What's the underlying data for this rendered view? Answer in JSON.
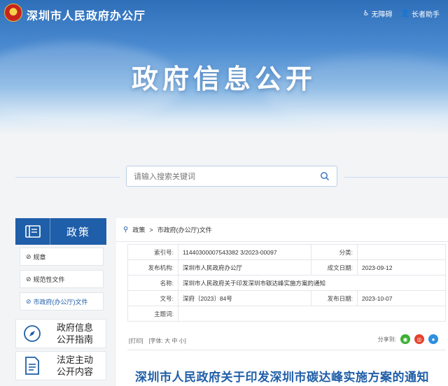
{
  "header": {
    "site_name": "深圳市人民政府办公厅",
    "barrier_free": "无障碍",
    "elder_mode": "长者助手",
    "hero_title": "政府信息公开"
  },
  "search": {
    "placeholder": "请输入搜索关键词"
  },
  "sidebar": {
    "header_label": "政策",
    "items": [
      {
        "label": "规章"
      },
      {
        "label": "规范性文件"
      },
      {
        "label": "市政府(办公厅)文件"
      }
    ],
    "blocks": [
      {
        "line1": "政府信息",
        "line2": "公开指南"
      },
      {
        "line1": "法定主动",
        "line2": "公开内容"
      }
    ]
  },
  "breadcrumb": {
    "root": "政策",
    "separator": ">",
    "current": "市政府(办公厅)文件"
  },
  "meta": {
    "index_label": "索引号:",
    "index_value": "11440300007543382 3/2023-00097",
    "category_label": "分类:",
    "category_value": "",
    "issuer_label": "发布机构:",
    "issuer_value": "深圳市人民政府办公厅",
    "date_made_label": "成文日期:",
    "date_made_value": "2023-09-12",
    "name_label": "名称:",
    "name_value": "深圳市人民政府关于印发深圳市碳达峰实施方案的通知",
    "doc_no_label": "文号:",
    "doc_no_value": "深府〔2023〕84号",
    "publish_label": "发布日期:",
    "publish_value": "2023-10-07",
    "keywords_label": "主题词:",
    "keywords_value": ""
  },
  "actions": {
    "print": "[打印]",
    "font": "[字体: 大 中 小]",
    "share_label": "分享到:"
  },
  "document": {
    "title": "深圳市人民政府关于印发深圳市碳达峰实施方案的通知"
  },
  "colors": {
    "primary": "#1f5ea8",
    "wechat": "#3cb034",
    "weibo": "#e4432d",
    "qq": "#2f8fe0"
  }
}
